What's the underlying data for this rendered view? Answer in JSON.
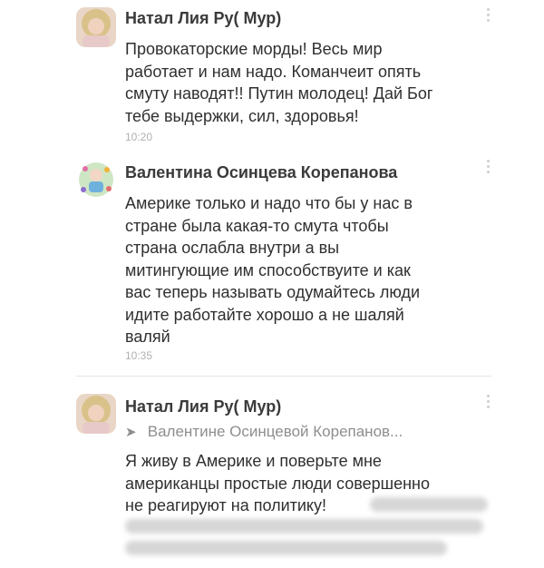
{
  "comments": [
    {
      "author": "Натал Лия Ру( Мур)",
      "lines": [
        "Провокаторские морды! Весь мир",
        "работает и нам надо. Команчеит опять",
        "смуту наводят!! Путин молодец! Дай Бог",
        "тебе выдержки, сил, здоровья!"
      ],
      "time": "10:20"
    },
    {
      "author": "Валентина Осинцева Корепанова",
      "lines": [
        "Америке только и надо что бы у нас в",
        "стране была какая-то смута чтобы",
        "страна ослабла внутри а вы",
        "митингующие им способствуите и как",
        "вас теперь называть одумайтесь люди",
        "идите работайте хорошо а не шаляй",
        "валяй"
      ],
      "time": "10:35"
    },
    {
      "author": "Натал Лия Ру( Мур)",
      "reply_to": "Валентине Осинцевой Корепанов...",
      "lines": [
        "Я живу в Америке и поверьте мне",
        "американцы простые люди совершенно",
        "не реагируют на политику!"
      ]
    }
  ],
  "colors": {
    "text": "#2f2f2f",
    "time": "#b0b0b0",
    "divider": "#e6e6e6"
  },
  "icons": [
    "avatar-photo",
    "reply-arrow-icon",
    "kebab-menu-icon"
  ]
}
